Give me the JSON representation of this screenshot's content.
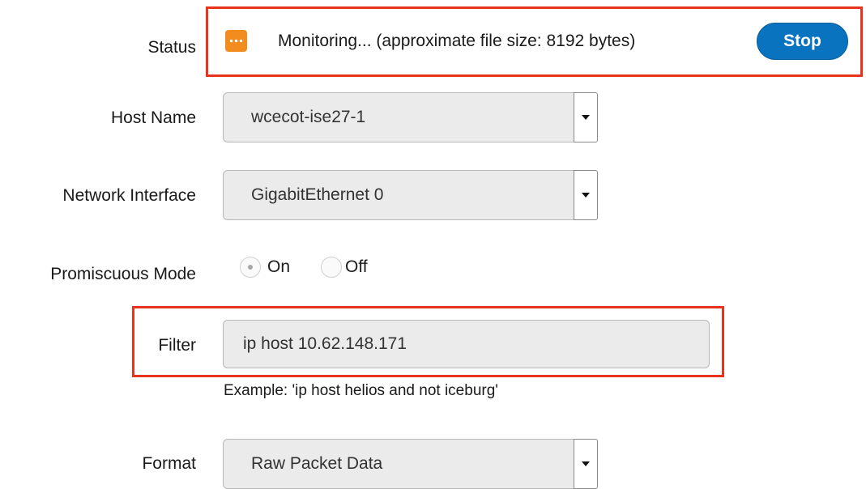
{
  "status": {
    "label": "Status",
    "text": "Monitoring... (approximate file size: 8192 bytes)",
    "icon": "in-progress-icon",
    "icon_color": "#f28c1f",
    "stop_label": "Stop",
    "stop_color": "#0a73bf"
  },
  "host_name": {
    "label": "Host Name",
    "value": "wcecot-ise27-1"
  },
  "network_interface": {
    "label": "Network Interface",
    "value": "GigabitEthernet 0"
  },
  "promiscuous_mode": {
    "label": "Promiscuous Mode",
    "options": [
      {
        "label": "On",
        "selected": true
      },
      {
        "label": "Off",
        "selected": false
      }
    ]
  },
  "filter": {
    "label": "Filter",
    "value": "ip host 10.62.148.171",
    "hint": "Example: 'ip host helios and not iceburg'"
  },
  "format": {
    "label": "Format",
    "value": "Raw Packet Data"
  },
  "highlight_color": "#e8341c"
}
